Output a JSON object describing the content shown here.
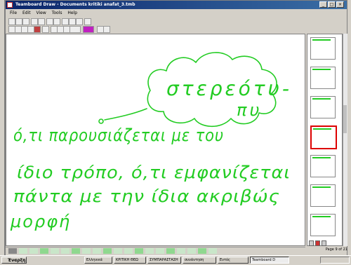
{
  "window": {
    "title": "Teamboard Draw - Documents kritiki anafat_3.tmb"
  },
  "menu": {
    "items": [
      "File",
      "Edit",
      "View",
      "Tools",
      "Help"
    ]
  },
  "canvas": {
    "cloud_text_line1": "στερεότυ-",
    "cloud_text_line2": "πυ",
    "handwriting": [
      "ό,τι παρουσιάζεται με του",
      "ίδιο τρόπο, ό,τι εμφανίζεται",
      "πάντα με την ίδια ακριβώς",
      "μορφή"
    ],
    "ink_color": "#22cc22"
  },
  "thumbnails": {
    "count": 7,
    "selected_index": 3
  },
  "pager": {
    "label": "Page 9 of 21"
  },
  "taskbar": {
    "start_label": "Έναρξη",
    "tasks": [
      "Eλληνικά",
      "ΚΡΙΤΙΚΗ ΘΕΩ",
      "ΣΥΜΠΑΡΑΣΤΑΣΗ",
      "συνάντηση",
      "Εντός",
      "Teamboard D"
    ],
    "active_task_index": 5
  },
  "colors": {
    "titlebar": "#0a246a",
    "selection_border": "#d00000",
    "ink": "#22cc22"
  }
}
